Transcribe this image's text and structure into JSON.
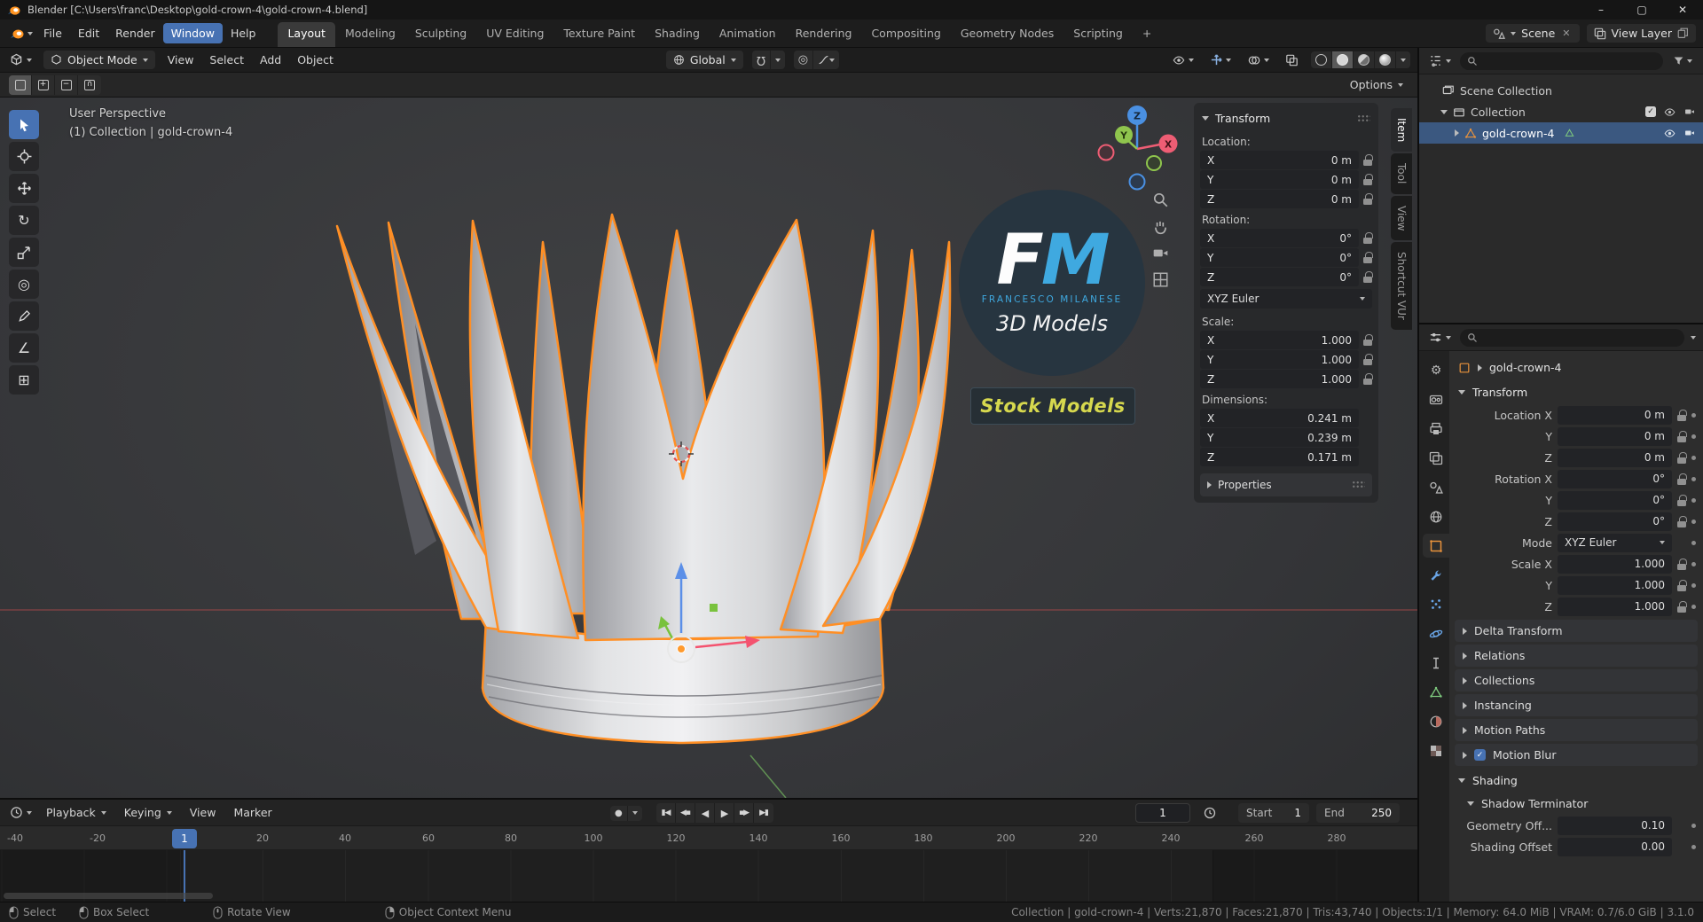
{
  "colors": {
    "accent": "#4772b3",
    "selection_outline": "#ff8f25",
    "axis_x": "#ee5d74",
    "axis_y": "#8fc54d",
    "axis_z": "#4a90e2",
    "watermark_blue": "#3fa9e0",
    "badge_yellow": "#d6d84e"
  },
  "icons": {
    "check": "✓",
    "close_x": "✕",
    "record": "●",
    "jump_start": "▮◀",
    "prev_key": "◀▪",
    "play_rev": "◀",
    "play": "▶",
    "next_key": "▪▶",
    "jump_end": "▶▮",
    "rotate_tool": "↻",
    "transform_tool": "◎",
    "measure_tool": "∠",
    "add_cube_tool": "⊞",
    "gear": "⚙",
    "magnet": "Ω",
    "plus": "+",
    "minus": "−",
    "intersect": "∩"
  },
  "title_bar": {
    "title": "Blender [C:\\Users\\franc\\Desktop\\gold-crown-4\\gold-crown-4.blend]",
    "minimize": "–",
    "maximize": "▢",
    "close": "✕"
  },
  "menu_bar": {
    "file": "File",
    "edit": "Edit",
    "render": "Render",
    "window": "Window",
    "help": "Help",
    "workspaces": {
      "layout": "Layout",
      "modeling": "Modeling",
      "sculpting": "Sculpting",
      "uv": "UV Editing",
      "paint": "Texture Paint",
      "shading": "Shading",
      "anim": "Animation",
      "rendering": "Rendering",
      "comp": "Compositing",
      "geo": "Geometry Nodes",
      "script": "Scripting",
      "add": "+"
    },
    "scene": "Scene",
    "view_layer": "View Layer"
  },
  "viewport": {
    "mode": "Object Mode",
    "menus": {
      "view": "View",
      "select": "Select",
      "add": "Add",
      "object": "Object"
    },
    "orientation": "Global",
    "options": "Options",
    "overlay_line1": "User Perspective",
    "overlay_line2": "(1) Collection | gold-crown-4",
    "axis_labels": {
      "x": "X",
      "y": "Y",
      "z": "Z"
    },
    "watermark": {
      "f": "F",
      "m": "M",
      "name": "FRANCESCO MILANESE",
      "tagline": "3D Models",
      "badge": "Stock Models"
    }
  },
  "npanel": {
    "tabs": {
      "item": "Item",
      "tool": "Tool",
      "view": "View",
      "custom": "Shortcut VUr"
    },
    "transform_title": "Transform",
    "location_label": "Location:",
    "rotation_label": "Rotation:",
    "scale_label": "Scale:",
    "dimensions_label": "Dimensions:",
    "x": "X",
    "y": "Y",
    "z": "Z",
    "loc": {
      "x": "0 m",
      "y": "0 m",
      "z": "0 m"
    },
    "rot": {
      "x": "0°",
      "y": "0°",
      "z": "0°"
    },
    "euler": "XYZ Euler",
    "scl": {
      "x": "1.000",
      "y": "1.000",
      "z": "1.000"
    },
    "dim": {
      "x": "0.241 m",
      "y": "0.239 m",
      "z": "0.171 m"
    },
    "properties_label": "Properties"
  },
  "outliner": {
    "scene_collection": "Scene Collection",
    "collection": "Collection",
    "object": "gold-crown-4"
  },
  "properties": {
    "breadcrumb": "gold-crown-4",
    "transform_title": "Transform",
    "rows": {
      "loc_x": "Location X",
      "loc_y": "Y",
      "loc_z": "Z",
      "rot_x": "Rotation X",
      "rot_y": "Y",
      "rot_z": "Z",
      "mode": "Mode",
      "mode_value": "XYZ Euler",
      "scl_x": "Scale X",
      "scl_y": "Y",
      "scl_z": "Z"
    },
    "values": {
      "loc": "0 m",
      "rot": "0°",
      "scl": "1.000"
    },
    "sections": {
      "delta": "Delta Transform",
      "relations": "Relations",
      "collections": "Collections",
      "instancing": "Instancing",
      "motion_paths": "Motion Paths",
      "motion_blur": "Motion Blur"
    },
    "shading_title": "Shading",
    "shadow_terminator": "Shadow Terminator",
    "geometry_offset_label": "Geometry Off...",
    "geometry_offset": "0.10",
    "shading_offset_label": "Shading Offset",
    "shading_offset": "0.00"
  },
  "timeline": {
    "playback": "Playback",
    "keying": "Keying",
    "view": "View",
    "marker": "Marker",
    "current_frame": "1",
    "start_label": "Start",
    "start_value": "1",
    "end_label": "End",
    "end_value": "250",
    "playhead": "1",
    "ticks": {
      "t0": "-40",
      "t1": "-20",
      "t2": "20",
      "t3": "40",
      "t4": "60",
      "t5": "80",
      "t6": "100",
      "t7": "120",
      "t8": "140",
      "t9": "160",
      "t10": "180",
      "t11": "200",
      "t12": "220",
      "t13": "240",
      "t14": "260",
      "t15": "280"
    }
  },
  "status_bar": {
    "hint_select": "Select",
    "hint_box": "Box Select",
    "hint_rotate": "Rotate View",
    "hint_context": "Object Context Menu",
    "stats": "Collection | gold-crown-4 | Verts:21,870 | Faces:21,870 | Tris:43,740 | Objects:1/1 | Memory: 64.0 MiB | VRAM: 0.7/6.0 GiB | 3.1.0"
  }
}
